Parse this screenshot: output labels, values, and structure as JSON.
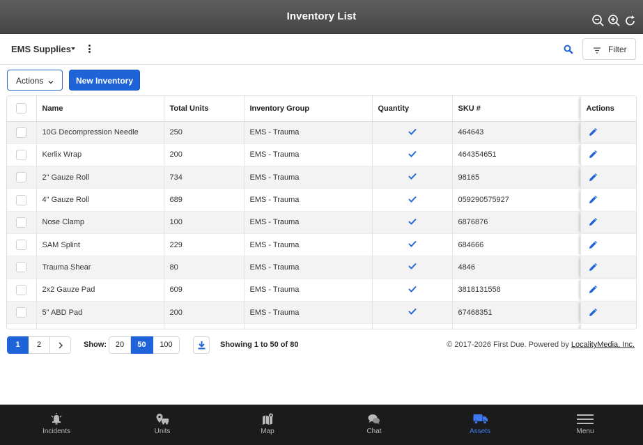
{
  "window": {
    "title": "Inventory List"
  },
  "header": {
    "list_name": "EMS Supplies",
    "filter_label": "Filter"
  },
  "toolbar": {
    "actions_label": "Actions",
    "new_label": "New Inventory"
  },
  "table": {
    "columns": [
      "Name",
      "Total Units",
      "Inventory Group",
      "Quantity",
      "SKU #",
      "Actions"
    ],
    "rows": [
      {
        "name": "10G Decompression Needle",
        "units": "250",
        "group": "EMS - Trauma",
        "sku": "464643"
      },
      {
        "name": "Kerlix Wrap",
        "units": "200",
        "group": "EMS - Trauma",
        "sku": "464354651"
      },
      {
        "name": "2\" Gauze Roll",
        "units": "734",
        "group": "EMS - Trauma",
        "sku": "98165"
      },
      {
        "name": "4\" Gauze Roll",
        "units": "689",
        "group": "EMS - Trauma",
        "sku": "059290575927"
      },
      {
        "name": "Nose Clamp",
        "units": "100",
        "group": "EMS - Trauma",
        "sku": "6876876"
      },
      {
        "name": "SAM Splint",
        "units": "229",
        "group": "EMS - Trauma",
        "sku": "684666"
      },
      {
        "name": "Trauma Shear",
        "units": "80",
        "group": "EMS - Trauma",
        "sku": "4846"
      },
      {
        "name": "2x2 Gauze Pad",
        "units": "609",
        "group": "EMS - Trauma",
        "sku": "3818131558"
      },
      {
        "name": "5\" ABD Pad",
        "units": "200",
        "group": "EMS - Trauma",
        "sku": "67468351"
      }
    ]
  },
  "pagination": {
    "pages": [
      "1",
      "2"
    ],
    "current": "1",
    "show_label": "Show:",
    "sizes": [
      "20",
      "50",
      "100"
    ],
    "selected_size": "50",
    "showing_text": "Showing 1 to 50 of 80"
  },
  "footer": {
    "copyright": "© 2017-2026 First Due. Powered by ",
    "link": "LocalityMedia, Inc."
  },
  "bottom_nav": {
    "items": [
      {
        "label": "Incidents",
        "icon": "bell-alert-icon"
      },
      {
        "label": "Units",
        "icon": "map-pin-vehicle-icon"
      },
      {
        "label": "Map",
        "icon": "map-icon"
      },
      {
        "label": "Chat",
        "icon": "chat-bubbles-icon"
      },
      {
        "label": "Assets",
        "icon": "truck-icon"
      },
      {
        "label": "Menu",
        "icon": "hamburger-menu-icon"
      }
    ],
    "active": "Assets",
    "active_color": "#3d78ee"
  },
  "colors": {
    "primary": "#1f63d8",
    "titlebar": "#4e4e4e",
    "nav_bg": "#1b1b1b"
  }
}
